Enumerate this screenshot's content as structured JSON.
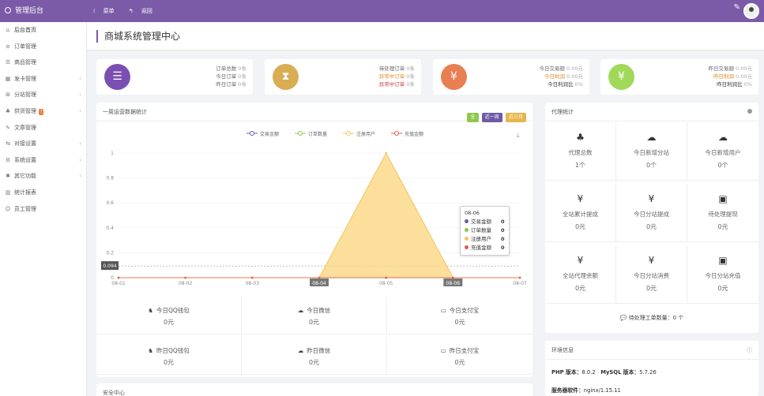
{
  "topbar": {
    "brand": "管理后台",
    "menu_label": "菜单",
    "back_label": "返回"
  },
  "sidebar": {
    "items": [
      {
        "label": "后台首页",
        "icon": "home-icon",
        "glyph": "⌂",
        "chevron": false
      },
      {
        "label": "订单管理",
        "icon": "list-icon",
        "glyph": "≡",
        "chevron": false
      },
      {
        "label": "商品管理",
        "icon": "goods-icon",
        "glyph": "☰",
        "chevron": false
      },
      {
        "label": "发卡管理",
        "icon": "grid-icon",
        "glyph": "▦",
        "chevron": true
      },
      {
        "label": "分站管理",
        "icon": "sitemap-icon",
        "glyph": "⊞",
        "chevron": true
      },
      {
        "label": "供货管理",
        "icon": "supply-icon",
        "glyph": "♣",
        "chevron": true,
        "badge": "!"
      },
      {
        "label": "文章管理",
        "icon": "article-icon",
        "glyph": "✎",
        "chevron": false
      },
      {
        "label": "对接设置",
        "icon": "link-icon",
        "glyph": "⇆",
        "chevron": true
      },
      {
        "label": "系统设置",
        "icon": "gear-icon",
        "glyph": "⚙",
        "chevron": true
      },
      {
        "label": "其它功能",
        "icon": "tools-icon",
        "glyph": "✱",
        "chevron": true
      },
      {
        "label": "统计报表",
        "icon": "chart-icon",
        "glyph": "▥",
        "chevron": false
      },
      {
        "label": "员工管理",
        "icon": "user-icon",
        "glyph": "☺",
        "chevron": false
      }
    ]
  },
  "header": {
    "title": "商城系统管理中心"
  },
  "stats": [
    {
      "color": "#7b4fb2",
      "glyph": "☰",
      "icon": "list-icon",
      "lines": [
        [
          "订单总数",
          "0",
          "条"
        ],
        [
          "今日订单",
          "0",
          "条"
        ],
        [
          "昨日订单",
          "0",
          "条"
        ]
      ]
    },
    {
      "color": "#d8ad53",
      "glyph": "⧗",
      "icon": "hourglass-icon",
      "lines": [
        [
          "待处理订单",
          "0",
          "条"
        ],
        [
          "异常中订单",
          "0",
          "条"
        ],
        [
          "异常中订单",
          "0",
          "条"
        ]
      ]
    },
    {
      "color": "#e77f52",
      "glyph": "¥",
      "icon": "yen-icon",
      "lines": [
        [
          "今日交易额",
          "0.00",
          "元"
        ],
        [
          "今日利润",
          "0.00",
          "元"
        ],
        [
          "今日利润比",
          "0",
          "%"
        ]
      ]
    },
    {
      "color": "#a1d85a",
      "glyph": "¥",
      "icon": "yen-icon",
      "lines": [
        [
          "昨日交易额",
          "0.00",
          "元"
        ],
        [
          "昨日利润",
          "0.00",
          "元"
        ],
        [
          "昨日利润比",
          "0",
          "%"
        ]
      ]
    }
  ],
  "chart_panel": {
    "title": "一周运营数据统计",
    "btn_all": "全",
    "btn_week": "近一周",
    "btn_month": "近三月"
  },
  "chart_data": {
    "type": "area",
    "x": [
      "08-01",
      "08-02",
      "08-03",
      "08-04",
      "08-05",
      "08-06",
      "08-07"
    ],
    "series": [
      {
        "name": "交易金额",
        "color": "#6d5bb0",
        "values": [
          0,
          0,
          0,
          0,
          0,
          0,
          0
        ]
      },
      {
        "name": "订单数量",
        "color": "#8fc84e",
        "values": [
          0,
          0,
          0,
          0,
          0,
          0,
          0
        ]
      },
      {
        "name": "注册用户",
        "color": "#f3c55e",
        "values": [
          0,
          0,
          0,
          0,
          1,
          0,
          0
        ]
      },
      {
        "name": "充值金额",
        "color": "#e35b4a",
        "values": [
          0,
          0,
          0,
          0,
          0,
          0,
          0
        ]
      }
    ],
    "yticks": [
      "0",
      "0.2",
      "0.4",
      "0.6",
      "0.8",
      "1"
    ],
    "ylim": [
      0,
      1
    ],
    "marker_value": "0.094",
    "tooltip": {
      "title": "08-06",
      "rows": [
        {
          "name": "交易金额",
          "value": "0"
        },
        {
          "name": "订单数量",
          "value": "0"
        },
        {
          "name": "注册用户",
          "value": "0"
        },
        {
          "name": "充值金额",
          "value": "0"
        }
      ]
    },
    "highlight_labels": [
      "08-04",
      "08-06"
    ]
  },
  "qq_stats": [
    {
      "label": "今日QQ钱包",
      "value": "0元",
      "icon": "qq-icon",
      "glyph": "♞"
    },
    {
      "label": "今日微信",
      "value": "0元",
      "icon": "wechat-icon",
      "glyph": "☁"
    },
    {
      "label": "今日支付宝",
      "value": "0元",
      "icon": "card-icon",
      "glyph": "▭"
    },
    {
      "label": "昨日QQ钱包",
      "value": "0元",
      "icon": "qq-icon",
      "glyph": "♞"
    },
    {
      "label": "昨日微信",
      "value": "0元",
      "icon": "wechat-icon",
      "glyph": "☁"
    },
    {
      "label": "昨日支付宝",
      "value": "0元",
      "icon": "card-icon",
      "glyph": "▭"
    }
  ],
  "agent_panel": {
    "title": "代理统计",
    "cells": [
      {
        "label": "代理总数",
        "value": "1个",
        "icon": "sitemap-icon",
        "glyph": "♣"
      },
      {
        "label": "今日新增分站",
        "value": "0个",
        "icon": "cloud-icon",
        "glyph": "☁"
      },
      {
        "label": "今日新增用户",
        "value": "0个",
        "icon": "cloud-icon",
        "glyph": "☁"
      },
      {
        "label": "全站累计提成",
        "value": "0元",
        "icon": "yen-icon",
        "glyph": "¥"
      },
      {
        "label": "今日分站提成",
        "value": "0元",
        "icon": "yen-icon",
        "glyph": "¥"
      },
      {
        "label": "待处理提现",
        "value": "0元",
        "icon": "money-icon",
        "glyph": "▣"
      },
      {
        "label": "全站代理余额",
        "value": "0元",
        "icon": "yen-icon",
        "glyph": "¥"
      },
      {
        "label": "今日分站消费",
        "value": "0元",
        "icon": "yen-icon",
        "glyph": "¥"
      },
      {
        "label": "今日分站充值",
        "value": "0元",
        "icon": "money-icon",
        "glyph": "▣"
      }
    ],
    "footer": "待处理工单数量：0 个"
  },
  "system_panel": {
    "title": "环境信息",
    "php_label": "PHP 版本：",
    "php_value": "8.0.2",
    "mysql_label": "MySQL 版本：",
    "mysql_value": "5.7.26",
    "server_label": "服务器软件：",
    "server_value": "nginx/1.15.11"
  },
  "security_panel": {
    "title": "安全中心"
  }
}
